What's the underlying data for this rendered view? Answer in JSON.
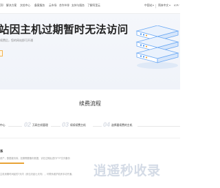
{
  "nav": {
    "left_items": [
      "顶）",
      "解决方案",
      "文档中心",
      "备案服务",
      "云市场",
      "合作伙伴",
      "支持与服务",
      "了解阿里云"
    ],
    "right_items": [
      "中国站",
      "简体中文",
      "ICP/"
    ]
  },
  "hero": {
    "title": "站因主机过期暂时无法访问",
    "subtitle": "续费后，您的网站即可开通"
  },
  "section": {
    "title": "续费流程"
  },
  "steps": [
    {
      "num": "",
      "label": "中心"
    },
    {
      "num": "02",
      "label": "万网主机管理"
    },
    {
      "num": "03",
      "label": "续续续费主机"
    },
    {
      "num": "04",
      "label": "选择要续费的主机"
    }
  ],
  "detail": {
    "title": "系",
    "line1": "资产，数据被清除，如果需要备份数据，请在过期后进行FTP文件备份",
    "line2": "主机到期时间起的7天内（即当天起七天内），可联系维护机房手动开通。"
  },
  "watermark": "逍遥秒收录",
  "colors": {
    "accent": "#e8a234",
    "server_blue": "#3d8ef0",
    "hero_bg": "#f3f6fb"
  }
}
